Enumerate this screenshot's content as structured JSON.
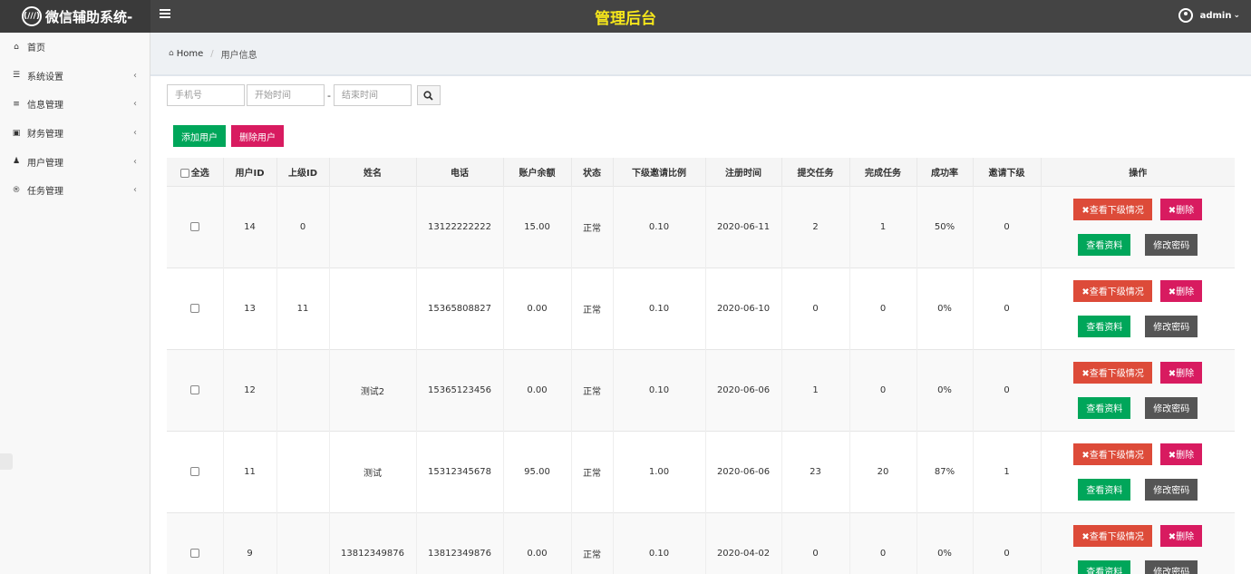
{
  "header": {
    "logo_glyph": "(///)",
    "app_name": "微信辅助系统-",
    "page_heading": "管理后台",
    "user": "admin"
  },
  "sidebar": {
    "items": [
      {
        "icon": "home-icon",
        "label": "首页",
        "has_arrow": false
      },
      {
        "icon": "server-icon",
        "label": "系统设置",
        "has_arrow": true
      },
      {
        "icon": "list-icon",
        "label": "信息管理",
        "has_arrow": true
      },
      {
        "icon": "money-icon",
        "label": "财务管理",
        "has_arrow": true
      },
      {
        "icon": "users-icon",
        "label": "用户管理",
        "has_arrow": true
      },
      {
        "icon": "registered-icon",
        "label": "任务管理",
        "has_arrow": true
      }
    ]
  },
  "breadcrumb": {
    "home": "Home",
    "current": "用户信息"
  },
  "filter": {
    "phone_placeholder": "手机号",
    "start_placeholder": "开始时间",
    "dash": "-",
    "end_placeholder": "结束时间"
  },
  "actions": {
    "add_label": "添加用户",
    "delete_label": "删除用户"
  },
  "table": {
    "columns": [
      "全选",
      "用户ID",
      "上级ID",
      "姓名",
      "电话",
      "账户余额",
      "状态",
      "下级邀请比例",
      "注册时间",
      "提交任务",
      "完成任务",
      "成功率",
      "邀请下级",
      "操作"
    ],
    "op_labels": {
      "view_sub": "✖查看下级情况",
      "delete": "✖删除",
      "view_info": "查看资料",
      "change_pwd": "修改密码"
    },
    "rows": [
      {
        "id": "14",
        "parent_id": "0",
        "name": "",
        "phone": "13122222222",
        "balance": "15.00",
        "status": "正常",
        "ratio": "0.10",
        "reg_date": "2020-06-11",
        "submitted": "2",
        "completed": "1",
        "rate": "50%",
        "invited": "0"
      },
      {
        "id": "13",
        "parent_id": "11",
        "name": "",
        "phone": "15365808827",
        "balance": "0.00",
        "status": "正常",
        "ratio": "0.10",
        "reg_date": "2020-06-10",
        "submitted": "0",
        "completed": "0",
        "rate": "0%",
        "invited": "0"
      },
      {
        "id": "12",
        "parent_id": "",
        "name": "测试2",
        "phone": "15365123456",
        "balance": "0.00",
        "status": "正常",
        "ratio": "0.10",
        "reg_date": "2020-06-06",
        "submitted": "1",
        "completed": "0",
        "rate": "0%",
        "invited": "0"
      },
      {
        "id": "11",
        "parent_id": "",
        "name": "测试",
        "phone": "15312345678",
        "balance": "95.00",
        "status": "正常",
        "ratio": "1.00",
        "reg_date": "2020-06-06",
        "submitted": "23",
        "completed": "20",
        "rate": "87%",
        "invited": "1"
      },
      {
        "id": "9",
        "parent_id": "",
        "name": "13812349876",
        "phone": "13812349876",
        "balance": "0.00",
        "status": "正常",
        "ratio": "0.10",
        "reg_date": "2020-04-02",
        "submitted": "0",
        "completed": "0",
        "rate": "0%",
        "invited": "0"
      }
    ]
  }
}
